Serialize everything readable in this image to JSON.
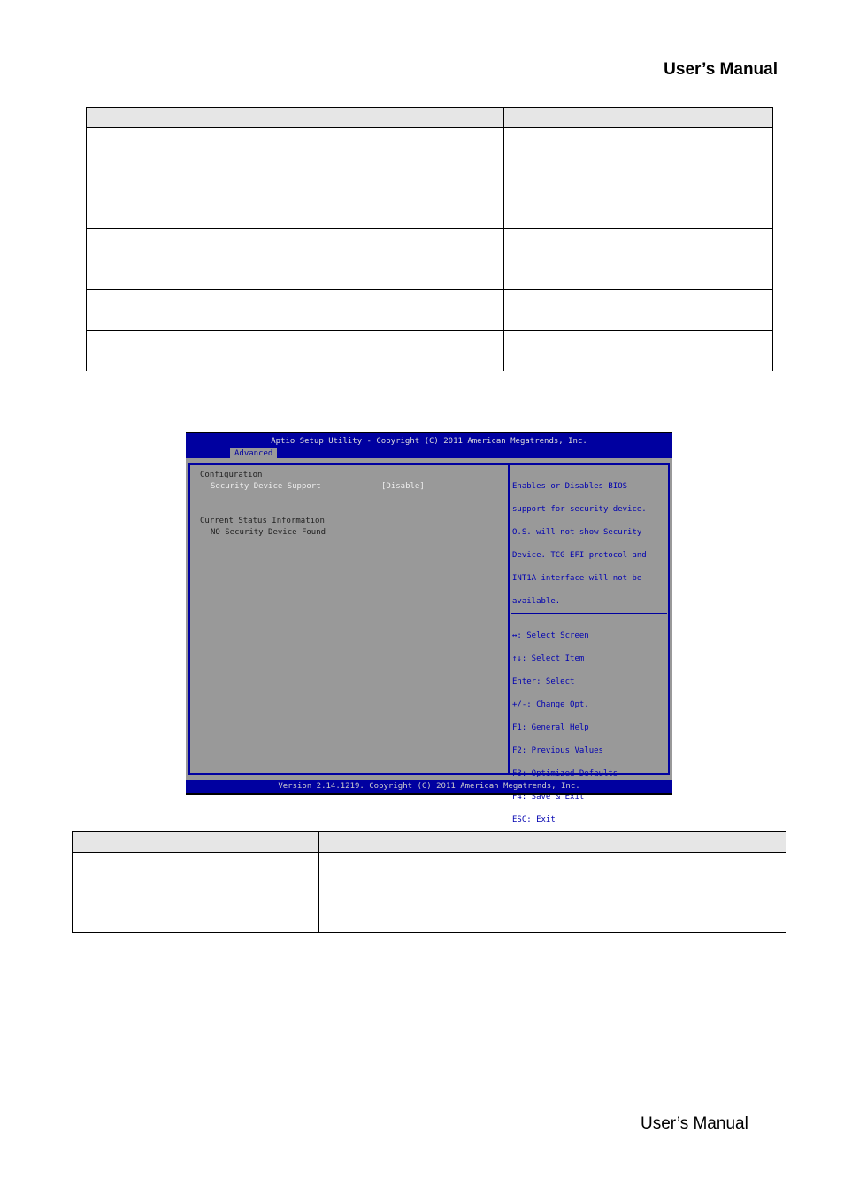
{
  "header": {
    "title": "User’s  Manual"
  },
  "footer": {
    "title": "User’s  Manual"
  },
  "bios": {
    "title": "Aptio Setup Utility - Copyright (C) 2011 American Megatrends, Inc.",
    "tab": "Advanced",
    "items": [
      {
        "label": "Configuration"
      },
      {
        "label": "Security Device Support",
        "value": "[Disable]"
      },
      {
        "label": "Current Status Information"
      },
      {
        "label": "NO Security Device Found"
      }
    ],
    "help": [
      "Enables or Disables BIOS",
      "support for security device.",
      "O.S. will not show Security",
      "Device. TCG EFI protocol and",
      "INT1A interface will not be",
      "available."
    ],
    "keys": [
      "↔: Select Screen",
      "↑↓: Select Item",
      "Enter: Select",
      "+/-: Change Opt.",
      "F1: General Help",
      "F2: Previous Values",
      "F3: Optimized Defaults",
      "F4: Save & Exit",
      "ESC: Exit"
    ],
    "version": "Version 2.14.1219. Copyright (C) 2011 American Megatrends, Inc.",
    "colors": {
      "bar": "#0000a0",
      "panel": "#999999"
    }
  }
}
